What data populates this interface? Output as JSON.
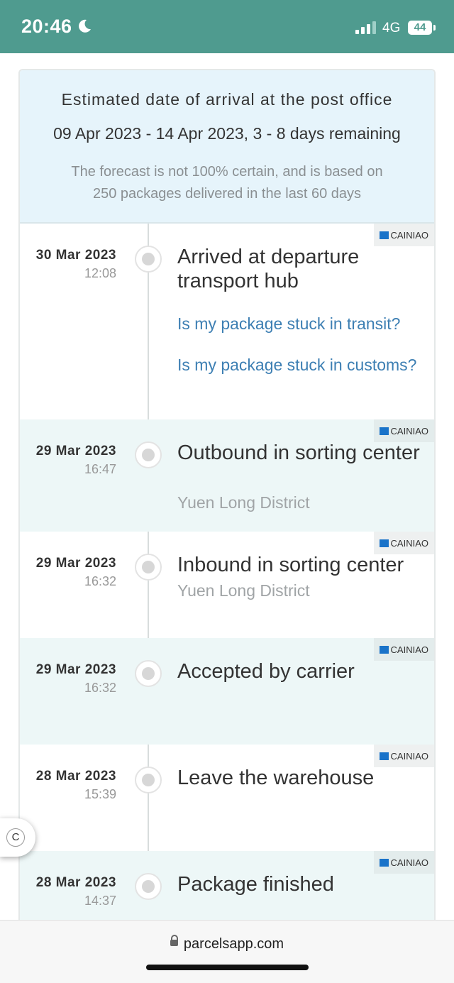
{
  "status_bar": {
    "time": "20:46",
    "network": "4G",
    "battery": "44",
    "icons": [
      "moon-icon",
      "signal-icon",
      "battery-icon"
    ]
  },
  "eta": {
    "title": "Estimated date of arrival at the post office",
    "range": "09 Apr 2023 - 14 Apr 2023, 3 - 8 days remaining",
    "note": "The forecast is not 100% certain, and is based on 250 packages delivered in the last 60 days"
  },
  "events": [
    {
      "date": "30 Mar 2023",
      "time": "12:08",
      "title": "Arrived at departure transport hub",
      "location": "",
      "carrier": "CAINIAO",
      "links": [
        "Is my package stuck in transit?",
        "Is my package stuck in customs?"
      ]
    },
    {
      "date": "29 Mar 2023",
      "time": "16:47",
      "title": "Outbound in sorting center",
      "location": "Yuen Long District",
      "carrier": "CAINIAO"
    },
    {
      "date": "29 Mar 2023",
      "time": "16:32",
      "title": "Inbound in sorting center",
      "location": "Yuen Long District",
      "carrier": "CAINIAO"
    },
    {
      "date": "29 Mar 2023",
      "time": "16:32",
      "title": "Accepted by carrier",
      "location": "",
      "carrier": "CAINIAO"
    },
    {
      "date": "28 Mar 2023",
      "time": "15:39",
      "title": "Leave the warehouse",
      "location": "",
      "carrier": "CAINIAO"
    },
    {
      "date": "28 Mar 2023",
      "time": "14:37",
      "title": "Package finished",
      "location": "",
      "carrier": "CAINIAO"
    }
  ],
  "floating_button": {
    "label": "C"
  },
  "browser": {
    "url": "parcelsapp.com"
  },
  "colors": {
    "header": "#4f9b8f",
    "eta_bg": "#e6f4fb",
    "link": "#3d7fb3",
    "alt_row": "#edf7f7"
  }
}
